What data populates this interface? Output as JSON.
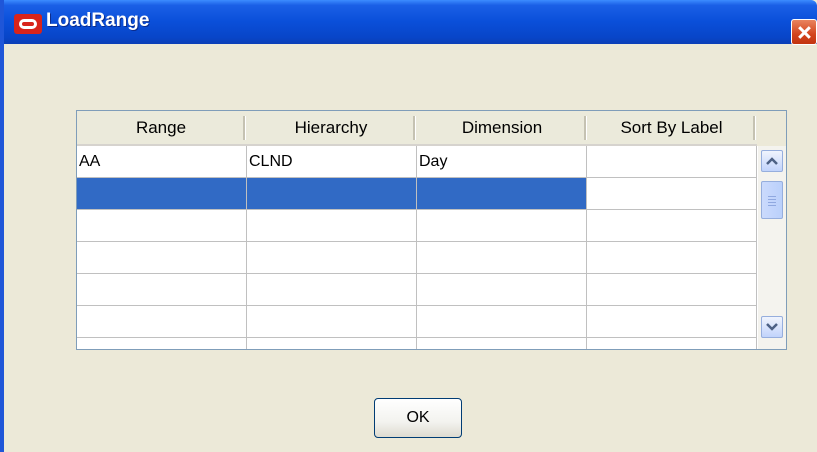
{
  "window": {
    "title": "LoadRange"
  },
  "table": {
    "columns": [
      "Range",
      "Hierarchy",
      "Dimension",
      "Sort By Label"
    ],
    "rows": [
      {
        "range": "AA",
        "hierarchy": "CLND",
        "dimension": "Day",
        "sort_by_label": true,
        "selected": false
      },
      {
        "range": "",
        "hierarchy": "",
        "dimension": "",
        "sort_by_label": false,
        "selected": true
      },
      {
        "range": "",
        "hierarchy": "",
        "dimension": "",
        "sort_by_label": false,
        "selected": false
      },
      {
        "range": "",
        "hierarchy": "",
        "dimension": "",
        "sort_by_label": false,
        "selected": false
      },
      {
        "range": "",
        "hierarchy": "",
        "dimension": "",
        "sort_by_label": false,
        "selected": false
      },
      {
        "range": "",
        "hierarchy": "",
        "dimension": "",
        "sort_by_label": false,
        "selected": false
      }
    ]
  },
  "buttons": {
    "ok_label": "OK"
  },
  "icons": {
    "app": "oracle-logo-icon",
    "close": "close-icon",
    "scroll_up": "chevron-up-icon",
    "scroll_down": "chevron-down-icon"
  },
  "colors": {
    "titlebar": "#0a4fd9",
    "selection": "#316ac5",
    "close": "#d3441c",
    "check": "#21a121"
  }
}
